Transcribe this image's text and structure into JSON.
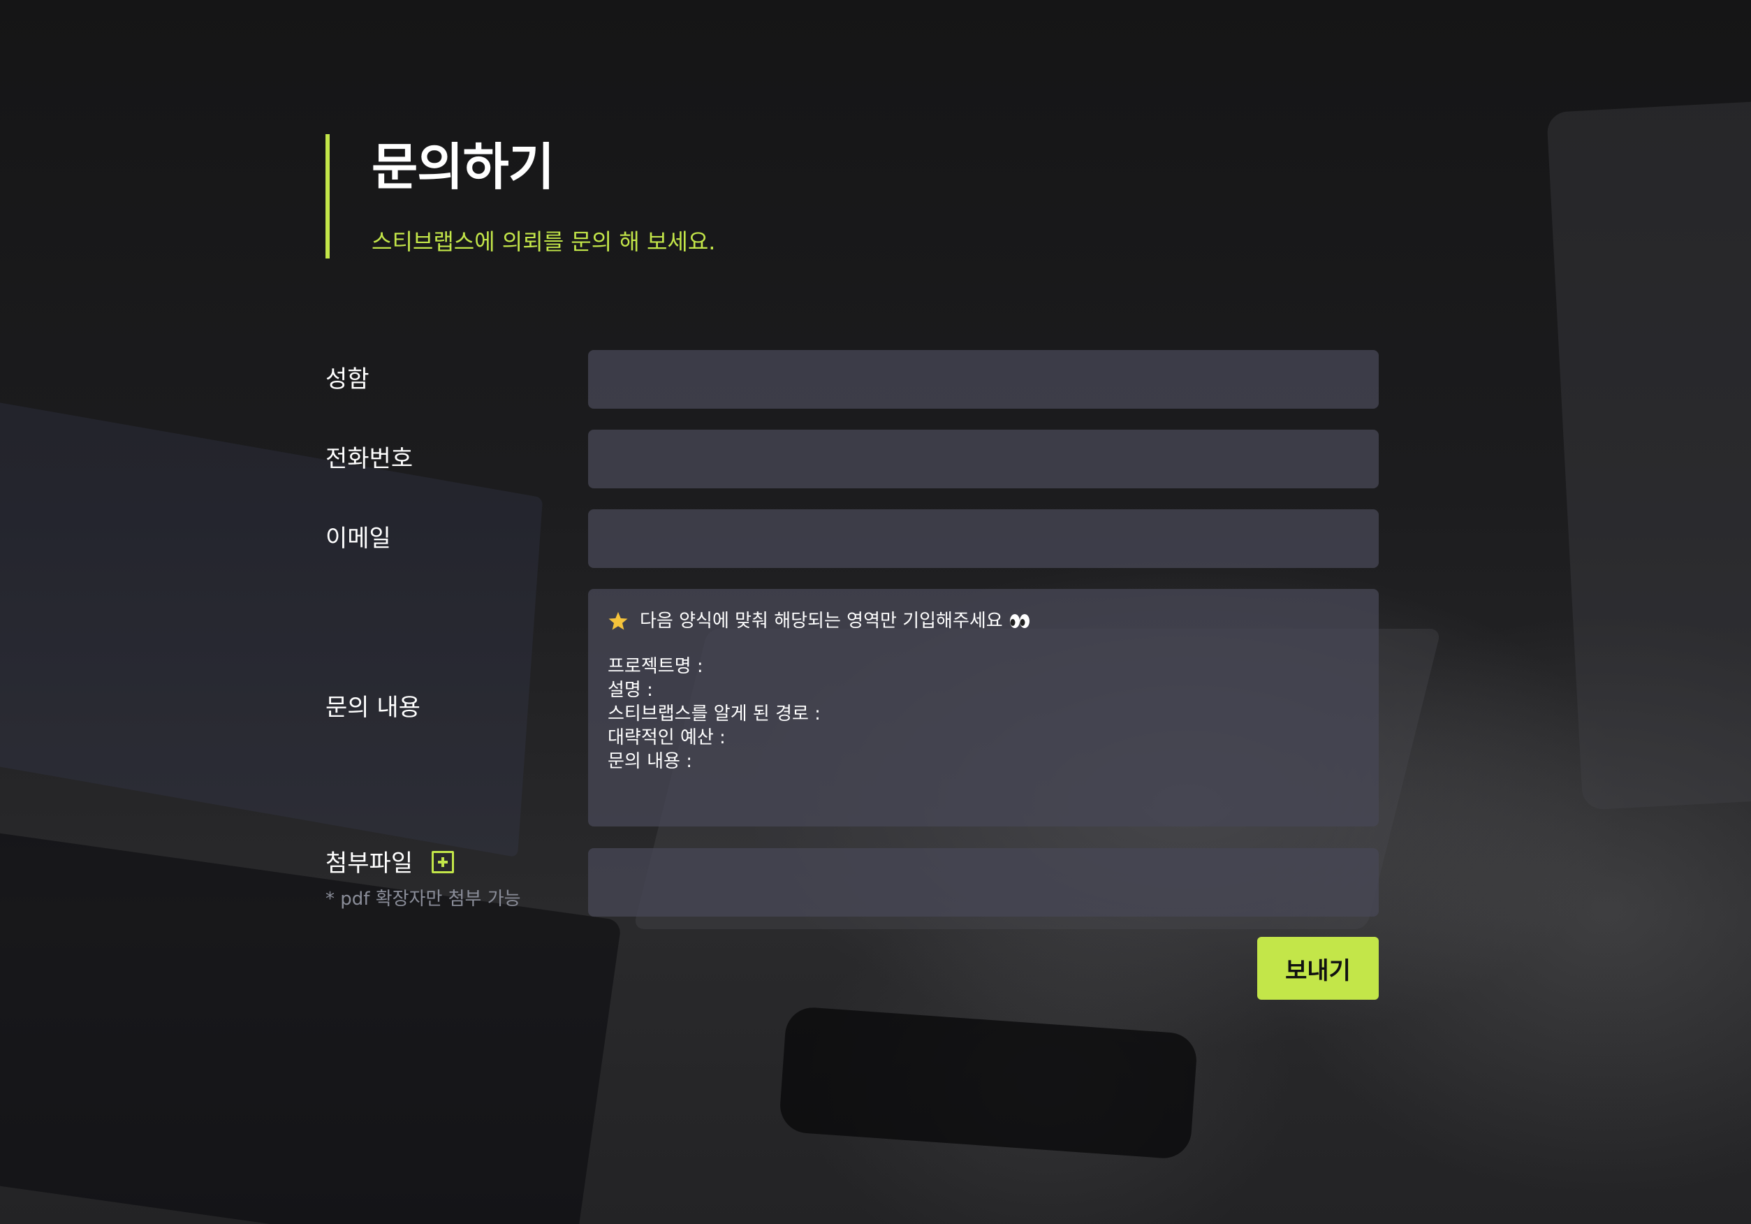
{
  "header": {
    "title": "문의하기",
    "subtitle": "스티브랩스에 의뢰를 문의 해 보세요."
  },
  "form": {
    "name_label": "성함",
    "phone_label": "전화번호",
    "email_label": "이메일",
    "inquiry_label": "문의 내용",
    "inquiry_hint": "다음 양식에 맞춰 해당되는 영역만 기입해주세요",
    "inquiry_template": [
      "프로젝트명 :",
      "설명 :",
      "스티브랩스를 알게 된 경로 :",
      "대략적인 예산 :",
      "문의 내용 :"
    ],
    "attachment_label": "첨부파일",
    "attachment_note": "* pdf 확장자만 첨부 가능",
    "submit_label": "보내기"
  },
  "colors": {
    "accent": "#c3e649",
    "field_bg": "#464655",
    "note": "#8a8d99"
  },
  "icons": {
    "hint": "star-icon",
    "hint_suffix": "eyes-icon",
    "attachment_add": "plus-square-icon"
  }
}
